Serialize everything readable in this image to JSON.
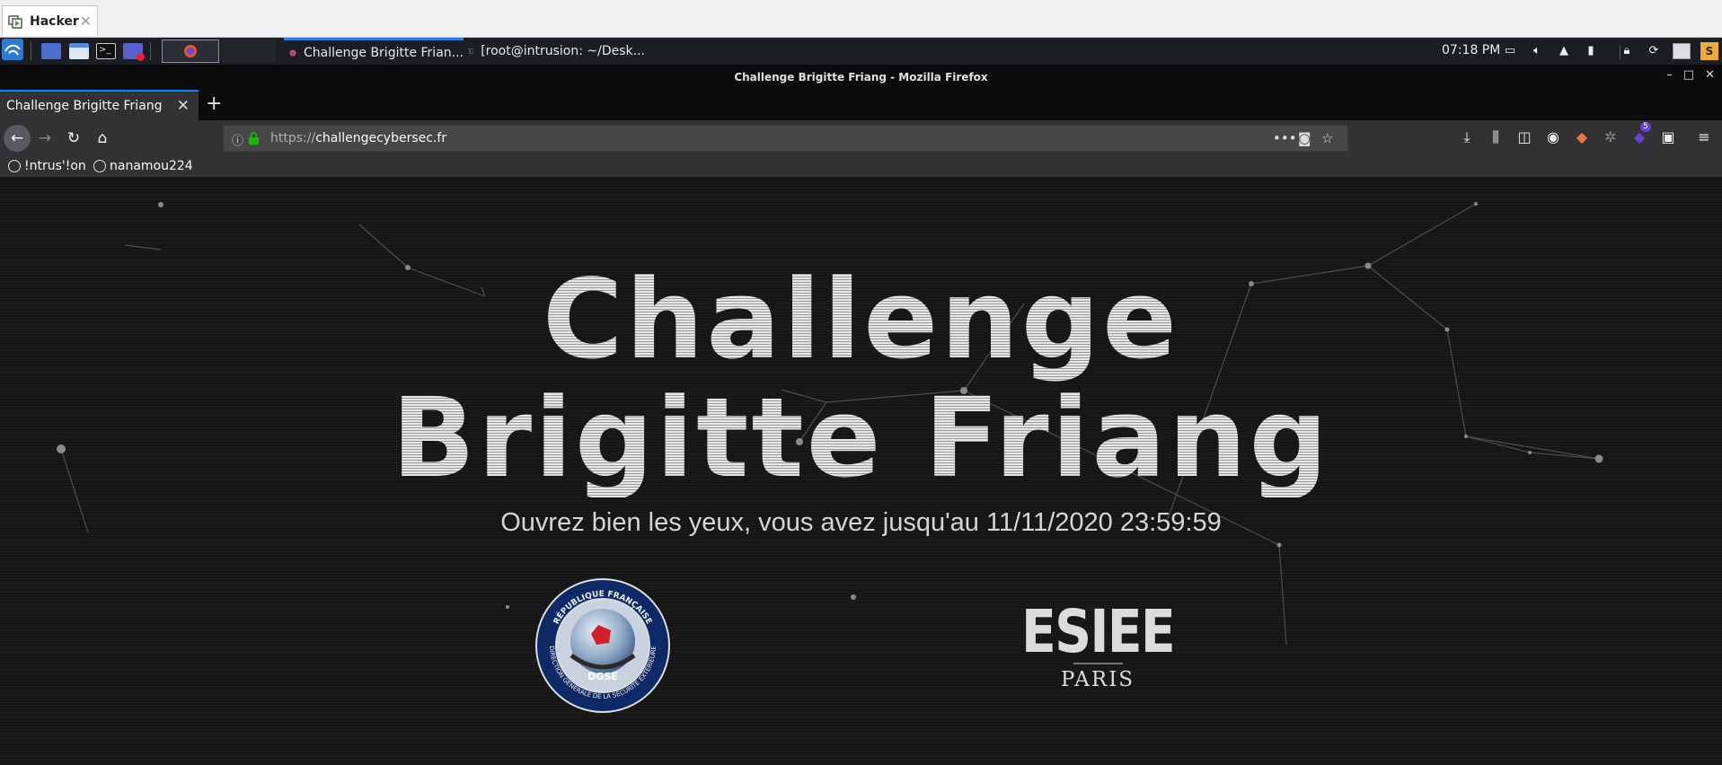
{
  "host": {
    "tab_label": "Hacker"
  },
  "panel": {
    "tasks": [
      {
        "label": "Challenge Brigitte Frian..."
      },
      {
        "label": "[root@intrusion: ~/Desk..."
      }
    ],
    "clock": "07:18 PM"
  },
  "window": {
    "title": "Challenge Brigitte Friang - Mozilla Firefox"
  },
  "browser": {
    "tab_title": "Challenge Brigitte Friang",
    "url_scheme": "https://",
    "url_host": "challengecybersec.fr",
    "extension_badge": "5",
    "bookmarks": [
      {
        "label": "!ntrus'!on"
      },
      {
        "label": "nanamou224"
      }
    ]
  },
  "page": {
    "title_line1": "Challenge",
    "title_line2": "Brigitte Friang",
    "subtitle": "Ouvrez bien les yeux, vous avez jusqu'au 11/11/2020 23:59:59",
    "dgse_ring_top": "RÉPUBLIQUE FRANÇAISE",
    "dgse_ring_bottom": "DIRECTION GÉNÉRALE DE LA SÉCURITÉ EXTÉRIEURE",
    "dgse_mark": "DGSE",
    "esiee_word": "ESIEE",
    "esiee_city": "PARIS"
  },
  "colors": {
    "accent": "#0a84ff",
    "page_bg": "#161616",
    "title_text": "#e6e6e6"
  }
}
